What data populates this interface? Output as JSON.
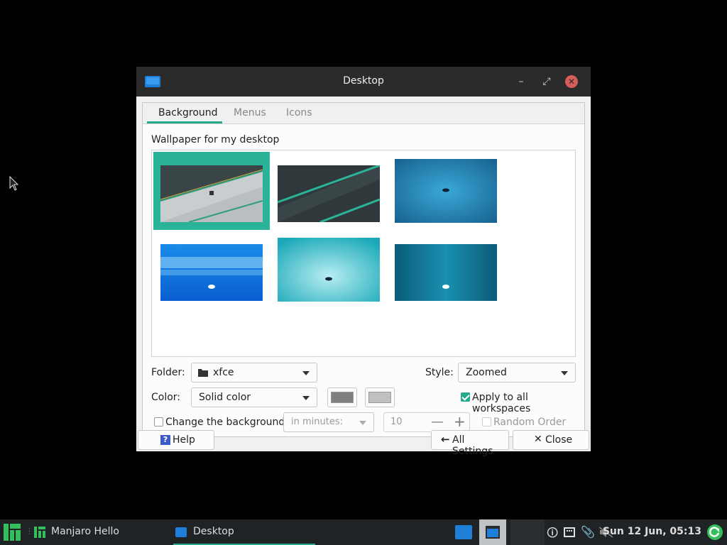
{
  "window": {
    "title": "Desktop",
    "tabs": [
      {
        "label": "Background",
        "active": true
      },
      {
        "label": "Menus",
        "active": false
      },
      {
        "label": "Icons",
        "active": false
      }
    ]
  },
  "background": {
    "wallpaper_label": "Wallpaper for my desktop",
    "folder_label": "Folder:",
    "folder_value": "xfce",
    "style_label": "Style:",
    "style_value": "Zoomed",
    "color_label": "Color:",
    "color_value": "Solid color",
    "color1": "#808080",
    "color2": "#c0c0c0",
    "apply_all_label": "Apply to all workspaces",
    "apply_all_checked": true,
    "change_bg_label": "Change the background",
    "change_bg_checked": false,
    "interval_unit": "in minutes:",
    "interval_value": "10",
    "random_order_label": "Random Order",
    "random_order_checked": false
  },
  "buttons": {
    "help": "Help",
    "all_settings": "All Settings",
    "close": "Close"
  },
  "taskbar": {
    "apps": [
      {
        "label": "Manjaro Hello"
      },
      {
        "label": "Desktop"
      }
    ],
    "clock": "Sun 12 Jun, 05:13"
  },
  "colors": {
    "accent": "#26a98b",
    "titlebar": "#2b2b2b",
    "close_button": "#d75c5c",
    "taskbar": "#1f2326"
  }
}
